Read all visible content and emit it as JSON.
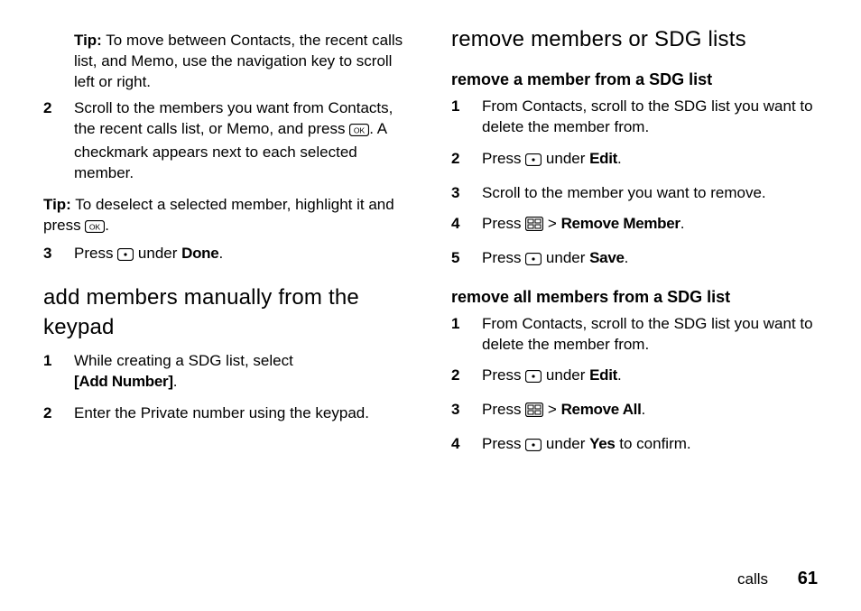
{
  "left": {
    "tip1": {
      "label": "Tip:",
      "text": "To move between Contacts, the recent calls list, and Memo, use the navigation key to scroll left or right."
    },
    "step2a": "Scroll to the members you want from Contacts, the recent calls list, or Memo, and press ",
    "step2b": ". A checkmark appears next to each selected member.",
    "tip2": {
      "label": "Tip:",
      "text_a": "To deselect a selected member, highlight it and press ",
      "text_b": "."
    },
    "step3a": "Press ",
    "step3b": " under ",
    "step3_done": "Done",
    "step3c": ".",
    "h_add": "add members manually from the keypad",
    "add_step1a": "While creating a SDG list, select ",
    "add_step1_val": "[Add Number]",
    "add_step1b": ".",
    "add_step2": "Enter the Private number using the keypad."
  },
  "right": {
    "h_remove": "remove members or SDG lists",
    "h_remove_member": "remove a member from a SDG list",
    "rm_step1": "From Contacts, scroll to the SDG list you want to delete the member from.",
    "rm_step2a": "Press ",
    "rm_step2b": " under ",
    "rm_step2_edit": "Edit",
    "rm_step2c": ".",
    "rm_step3": "Scroll to the member you want to remove.",
    "rm_step4a": "Press ",
    "rm_step4b": " > ",
    "rm_step4_val": "Remove Member",
    "rm_step4c": ".",
    "rm_step5a": "Press ",
    "rm_step5b": " under ",
    "rm_step5_save": "Save",
    "rm_step5c": ".",
    "h_remove_all": "remove all members from a SDG list",
    "ra_step1": "From Contacts, scroll to the SDG list you want to delete the member from.",
    "ra_step2a": "Press ",
    "ra_step2b": " under ",
    "ra_step2_edit": "Edit",
    "ra_step2c": ".",
    "ra_step3a": "Press ",
    "ra_step3b": " > ",
    "ra_step3_val": "Remove All",
    "ra_step3c": ".",
    "ra_step4a": "Press ",
    "ra_step4b": " under ",
    "ra_step4_yes": "Yes",
    "ra_step4c": " to confirm."
  },
  "nums": {
    "n1": "1",
    "n2": "2",
    "n3": "3",
    "n4": "4",
    "n5": "5"
  },
  "footer": {
    "section": "calls",
    "page": "61"
  }
}
